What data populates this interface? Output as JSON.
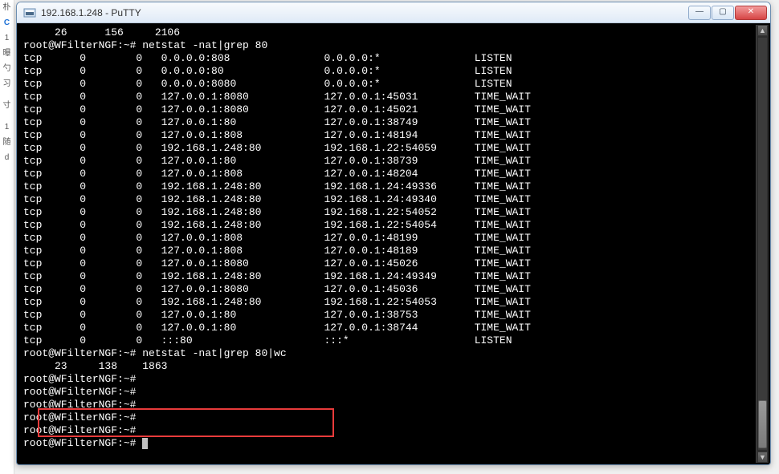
{
  "window": {
    "title": "192.168.1.248 - PuTTY"
  },
  "left_fragments": [
    "朴",
    "C",
    "1",
    "曝",
    "勺",
    "习",
    "",
    "寸",
    "",
    "1",
    "随",
    "d"
  ],
  "header_line": "     26      156     2106",
  "prompt1": "root@WFilterNGF:~# netstat -nat|grep 80",
  "netstat_rows": [
    {
      "proto": "tcp",
      "r": "0",
      "s": "0",
      "local": "0.0.0.0:808",
      "remote": "0.0.0.0:*",
      "state": "LISTEN"
    },
    {
      "proto": "tcp",
      "r": "0",
      "s": "0",
      "local": "0.0.0.0:80",
      "remote": "0.0.0.0:*",
      "state": "LISTEN"
    },
    {
      "proto": "tcp",
      "r": "0",
      "s": "0",
      "local": "0.0.0.0:8080",
      "remote": "0.0.0.0:*",
      "state": "LISTEN"
    },
    {
      "proto": "tcp",
      "r": "0",
      "s": "0",
      "local": "127.0.0.1:8080",
      "remote": "127.0.0.1:45031",
      "state": "TIME_WAIT"
    },
    {
      "proto": "tcp",
      "r": "0",
      "s": "0",
      "local": "127.0.0.1:8080",
      "remote": "127.0.0.1:45021",
      "state": "TIME_WAIT"
    },
    {
      "proto": "tcp",
      "r": "0",
      "s": "0",
      "local": "127.0.0.1:80",
      "remote": "127.0.0.1:38749",
      "state": "TIME_WAIT"
    },
    {
      "proto": "tcp",
      "r": "0",
      "s": "0",
      "local": "127.0.0.1:808",
      "remote": "127.0.0.1:48194",
      "state": "TIME_WAIT"
    },
    {
      "proto": "tcp",
      "r": "0",
      "s": "0",
      "local": "192.168.1.248:80",
      "remote": "192.168.1.22:54059",
      "state": "TIME_WAIT"
    },
    {
      "proto": "tcp",
      "r": "0",
      "s": "0",
      "local": "127.0.0.1:80",
      "remote": "127.0.0.1:38739",
      "state": "TIME_WAIT"
    },
    {
      "proto": "tcp",
      "r": "0",
      "s": "0",
      "local": "127.0.0.1:808",
      "remote": "127.0.0.1:48204",
      "state": "TIME_WAIT"
    },
    {
      "proto": "tcp",
      "r": "0",
      "s": "0",
      "local": "192.168.1.248:80",
      "remote": "192.168.1.24:49336",
      "state": "TIME_WAIT"
    },
    {
      "proto": "tcp",
      "r": "0",
      "s": "0",
      "local": "192.168.1.248:80",
      "remote": "192.168.1.24:49340",
      "state": "TIME_WAIT"
    },
    {
      "proto": "tcp",
      "r": "0",
      "s": "0",
      "local": "192.168.1.248:80",
      "remote": "192.168.1.22:54052",
      "state": "TIME_WAIT"
    },
    {
      "proto": "tcp",
      "r": "0",
      "s": "0",
      "local": "192.168.1.248:80",
      "remote": "192.168.1.22:54054",
      "state": "TIME_WAIT"
    },
    {
      "proto": "tcp",
      "r": "0",
      "s": "0",
      "local": "127.0.0.1:808",
      "remote": "127.0.0.1:48199",
      "state": "TIME_WAIT"
    },
    {
      "proto": "tcp",
      "r": "0",
      "s": "0",
      "local": "127.0.0.1:808",
      "remote": "127.0.0.1:48189",
      "state": "TIME_WAIT"
    },
    {
      "proto": "tcp",
      "r": "0",
      "s": "0",
      "local": "127.0.0.1:8080",
      "remote": "127.0.0.1:45026",
      "state": "TIME_WAIT"
    },
    {
      "proto": "tcp",
      "r": "0",
      "s": "0",
      "local": "192.168.1.248:80",
      "remote": "192.168.1.24:49349",
      "state": "TIME_WAIT"
    },
    {
      "proto": "tcp",
      "r": "0",
      "s": "0",
      "local": "127.0.0.1:8080",
      "remote": "127.0.0.1:45036",
      "state": "TIME_WAIT"
    },
    {
      "proto": "tcp",
      "r": "0",
      "s": "0",
      "local": "192.168.1.248:80",
      "remote": "192.168.1.22:54053",
      "state": "TIME_WAIT"
    },
    {
      "proto": "tcp",
      "r": "0",
      "s": "0",
      "local": "127.0.0.1:80",
      "remote": "127.0.0.1:38753",
      "state": "TIME_WAIT"
    },
    {
      "proto": "tcp",
      "r": "0",
      "s": "0",
      "local": "127.0.0.1:80",
      "remote": "127.0.0.1:38744",
      "state": "TIME_WAIT"
    },
    {
      "proto": "tcp",
      "r": "0",
      "s": "0",
      "local": ":::80",
      "remote": ":::*",
      "state": "LISTEN"
    }
  ],
  "prompt2": "root@WFilterNGF:~# netstat -nat|grep 80|wc",
  "wc_line": "     23     138    1863",
  "idle_prompts": [
    "root@WFilterNGF:~#",
    "root@WFilterNGF:~#",
    "root@WFilterNGF:~#",
    "root@WFilterNGF:~#",
    "root@WFilterNGF:~#",
    "root@WFilterNGF:~#"
  ]
}
